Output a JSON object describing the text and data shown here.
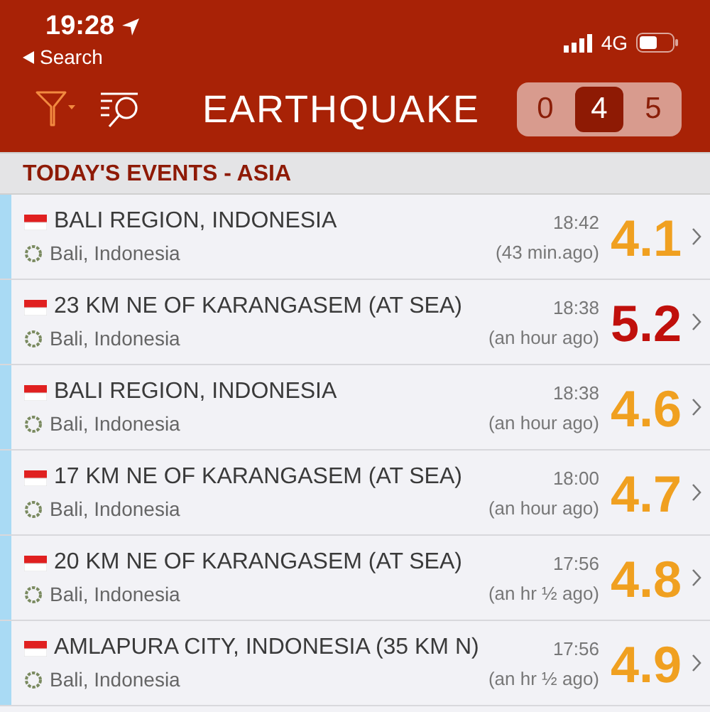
{
  "status_bar": {
    "time": "19:28",
    "back_label": "Search",
    "network": "4G"
  },
  "toolbar": {
    "title": "EARTHQUAKE",
    "magnitude_filter": [
      {
        "label": "0",
        "selected": false
      },
      {
        "label": "4",
        "selected": true
      },
      {
        "label": "5",
        "selected": false
      }
    ]
  },
  "section": {
    "title": "TODAY'S EVENTS - ASIA"
  },
  "events": [
    {
      "place": "BALI REGION, INDONESIA",
      "region": "Bali, Indonesia",
      "time": "18:42",
      "ago": "(43 min.ago)",
      "magnitude": "4.1",
      "color": "#f0a020"
    },
    {
      "place": "23 KM NE OF KARANGASEM (AT SEA)",
      "region": "Bali, Indonesia",
      "time": "18:38",
      "ago": "(an hour ago)",
      "magnitude": "5.2",
      "color": "#c0100c"
    },
    {
      "place": "BALI REGION, INDONESIA",
      "region": "Bali, Indonesia",
      "time": "18:38",
      "ago": "(an hour ago)",
      "magnitude": "4.6",
      "color": "#f0a020"
    },
    {
      "place": "17 KM NE OF KARANGASEM (AT SEA)",
      "region": "Bali, Indonesia",
      "time": "18:00",
      "ago": "(an hour ago)",
      "magnitude": "4.7",
      "color": "#f0a020"
    },
    {
      "place": "20 KM NE OF KARANGASEM (AT SEA)",
      "region": "Bali, Indonesia",
      "time": "17:56",
      "ago": "(an hr ½ ago)",
      "magnitude": "4.8",
      "color": "#f0a020"
    },
    {
      "place": "AMLAPURA CITY, INDONESIA (35 KM N)",
      "region": "Bali, Indonesia",
      "time": "17:56",
      "ago": "(an hr ½ ago)",
      "magnitude": "4.9",
      "color": "#f0a020"
    }
  ]
}
